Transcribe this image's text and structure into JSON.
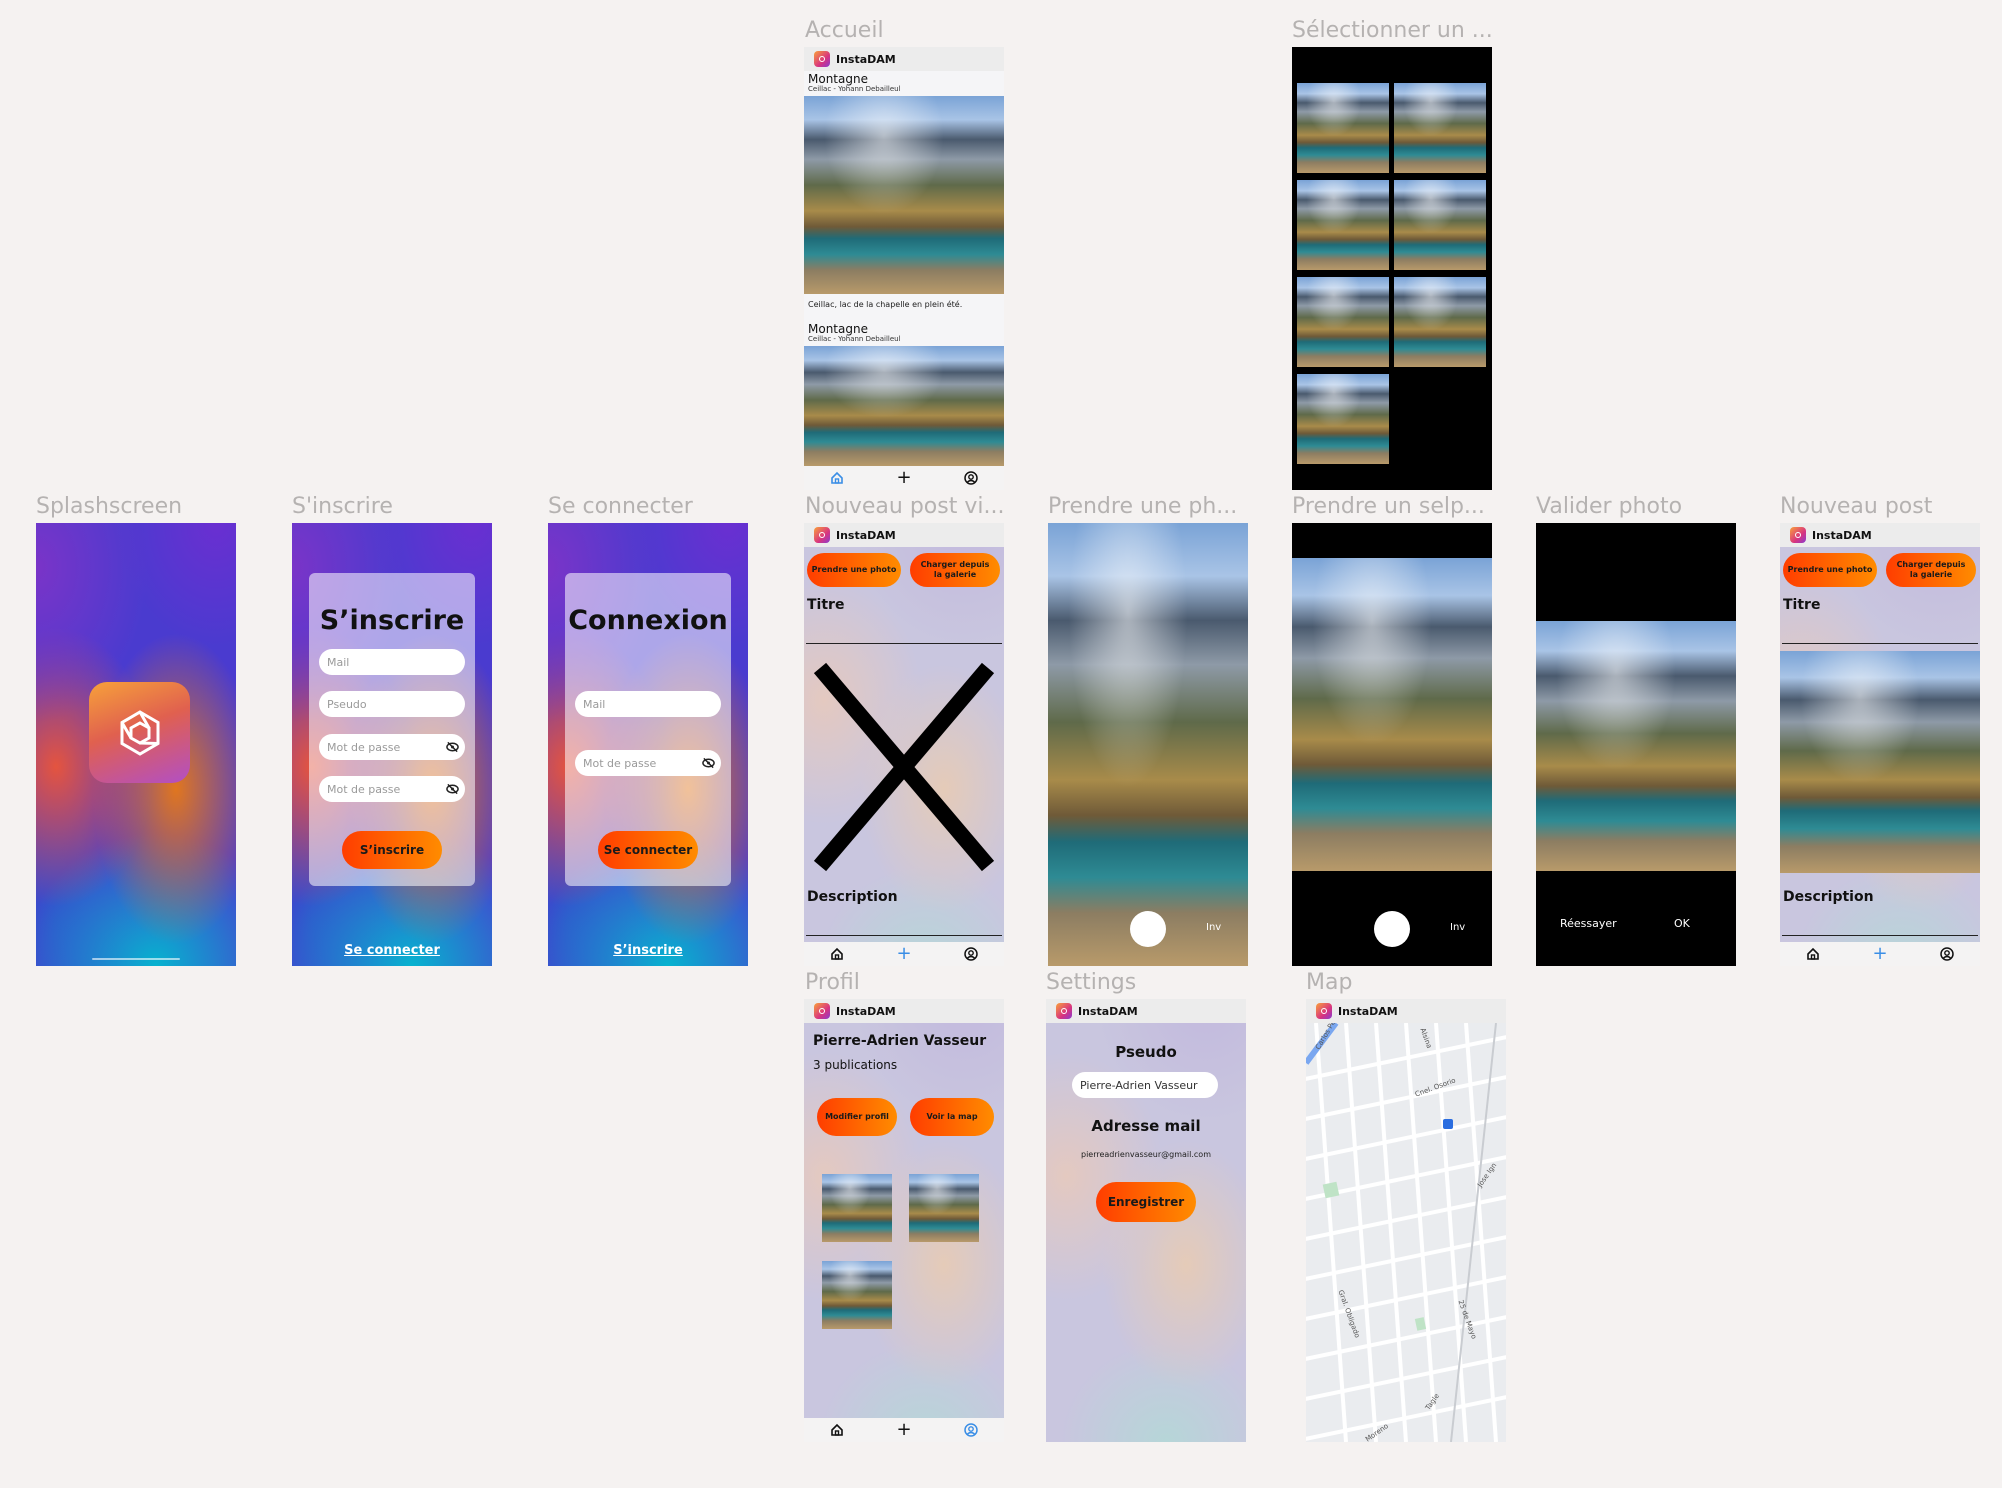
{
  "app_name": "InstaDAM",
  "frame_titles": {
    "splash": "Splashscreen",
    "signup": "S'inscrire",
    "login": "Se connecter",
    "accueil": "Accueil",
    "select": "Sélectionner un ...",
    "newpost_empty": "Nouveau post vi...",
    "take_photo": "Prendre une ph...",
    "take_selfie": "Prendre un selp...",
    "validate": "Valider photo",
    "newpost": "Nouveau post",
    "profile": "Profil",
    "settings": "Settings",
    "map": "Map"
  },
  "signup": {
    "title": "S’inscrire",
    "mail_placeholder": "Mail",
    "pseudo_placeholder": "Pseudo",
    "password_placeholder": "Mot de passe",
    "password_confirm_placeholder": "Mot de passe",
    "submit": "S’inscrire",
    "alt_link": "Se connecter"
  },
  "login": {
    "title": "Connexion",
    "mail_placeholder": "Mail",
    "password_placeholder": "Mot de passe",
    "submit": "Se connecter",
    "alt_link": "S’inscrire"
  },
  "feed": {
    "posts": [
      {
        "title": "Montagne",
        "meta": "Ceillac - Yohann Debailleul",
        "caption": "Ceillac, lac de la chapelle en plein été."
      },
      {
        "title": "Montagne",
        "meta": "Ceillac - Yohann Debailleul",
        "caption": ""
      }
    ]
  },
  "newpost": {
    "take_photo": "Prendre une photo",
    "gallery": "Charger depuis la galerie",
    "title_label": "Titre",
    "description_label": "Description"
  },
  "camera": {
    "switch_label": "Inv"
  },
  "validate": {
    "retry": "Réessayer",
    "ok": "OK"
  },
  "profile": {
    "name": "Pierre-Adrien Vasseur",
    "publications": "3 publications",
    "edit_button": "Modifier profil",
    "map_button": "Voir la map"
  },
  "settings": {
    "pseudo_label": "Pseudo",
    "pseudo_value": "Pierre-Adrien Vasseur",
    "mail_label": "Adresse mail",
    "mail_value": "pierreadrienvasseur@gmail.com",
    "save_button": "Enregistrer"
  },
  "map": {
    "streets": [
      "Carlos Pellegrini",
      "Alsina",
      "Cnel. Osorio",
      "Jose Ign",
      "Gral. Obligado",
      "25 de Mayo",
      "Tagle",
      "Moreno"
    ]
  },
  "icons": {
    "home": "home-icon",
    "add": "plus-icon",
    "profile": "profile-icon",
    "eye": "eye-off-icon",
    "logo": "instadam-logo"
  },
  "colors": {
    "accent_orange": "#ff5a00",
    "nav_active": "#3a8ee6",
    "frame_title": "#b5b2b1"
  }
}
